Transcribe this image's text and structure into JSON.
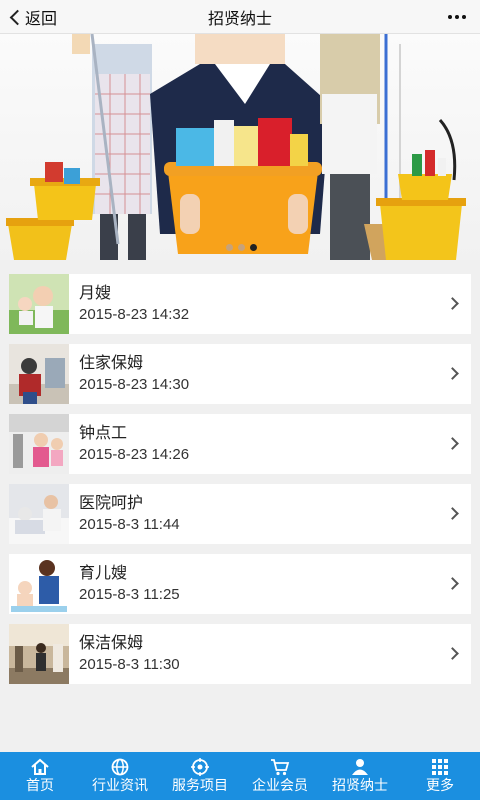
{
  "header": {
    "back_label": "返回",
    "title": "招贤纳士"
  },
  "banner": {
    "slide_count": 3,
    "active_slide": 3
  },
  "list": [
    {
      "title": "月嫂",
      "date": "2015-8-23 14:32"
    },
    {
      "title": "住家保姆",
      "date": "2015-8-23 14:30"
    },
    {
      "title": "钟点工",
      "date": "2015-8-23 14:26"
    },
    {
      "title": "医院呵护",
      "date": "2015-8-3 11:44"
    },
    {
      "title": "育儿嫂",
      "date": "2015-8-3 11:25"
    },
    {
      "title": "保洁保姆",
      "date": "2015-8-3 11:30"
    }
  ],
  "tabbar": [
    {
      "label": "首页",
      "icon": "home-icon"
    },
    {
      "label": "行业资讯",
      "icon": "globe-icon"
    },
    {
      "label": "服务项目",
      "icon": "target-icon"
    },
    {
      "label": "企业会员",
      "icon": "cart-icon"
    },
    {
      "label": "招贤纳士",
      "icon": "person-icon"
    },
    {
      "label": "更多",
      "icon": "grid-icon"
    }
  ],
  "colors": {
    "tabbar": "#1b8fe0",
    "header_bg": "#f7f7f7",
    "page_bg": "#f0f0f0"
  }
}
